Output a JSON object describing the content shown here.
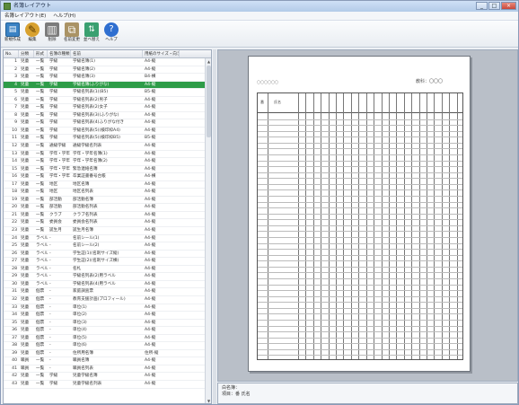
{
  "window": {
    "title": "名簿レイアウト",
    "controls": [
      "_",
      "□",
      "×"
    ]
  },
  "menu": [
    {
      "label": "名簿レイアウト(E)"
    },
    {
      "label": "ヘルプ(H)"
    }
  ],
  "toolbar": [
    {
      "label": "新規作成",
      "icon": "new-doc-icon",
      "glyph": "▤"
    },
    {
      "label": "編集",
      "icon": "pencil-icon",
      "glyph": "✎"
    },
    {
      "label": "削除",
      "icon": "trash-icon",
      "glyph": "▥"
    },
    {
      "label": "名前変更",
      "icon": "copy-icon",
      "glyph": "⧉"
    },
    {
      "label": "並べ替え",
      "icon": "sort-icon",
      "glyph": "⇅"
    },
    {
      "label": "ヘルプ",
      "icon": "help-icon",
      "glyph": "?"
    }
  ],
  "list": {
    "columns": [
      "No.",
      "分類",
      "形式",
      "名簿の種類",
      "名前",
      "用紙のサイズ・向き"
    ],
    "selected_index": 3,
    "rows": [
      [
        "1",
        "児童",
        "一覧",
        "学級",
        "学級名簿(1)",
        "A4-縦"
      ],
      [
        "2",
        "児童",
        "一覧",
        "学級",
        "学級名簿(2)",
        "A4-縦"
      ],
      [
        "3",
        "児童",
        "一覧",
        "学級",
        "学級名簿(3)",
        "B4-横"
      ],
      [
        "4",
        "児童",
        "一覧",
        "学級",
        "学級名簿(ふりがな)",
        "A4-縦"
      ],
      [
        "5",
        "児童",
        "一覧",
        "学級",
        "学級名列表(1)(B5)",
        "B5-縦"
      ],
      [
        "6",
        "児童",
        "一覧",
        "学級",
        "学級名列表(2)男子",
        "A4-縦"
      ],
      [
        "7",
        "児童",
        "一覧",
        "学級",
        "学級名列表(2)女子",
        "A4-縦"
      ],
      [
        "8",
        "児童",
        "一覧",
        "学級",
        "学級名列表(3)(ふりがな)",
        "A4-縦"
      ],
      [
        "9",
        "児童",
        "一覧",
        "学級",
        "学級名列表(4)ふりがな付き",
        "A4-縦"
      ],
      [
        "10",
        "児童",
        "一覧",
        "学級",
        "学級名列表(5)(検印枠A4)",
        "A4-縦"
      ],
      [
        "11",
        "児童",
        "一覧",
        "学級",
        "学級名列表(5)(検印枠B5)",
        "B5-縦"
      ],
      [
        "12",
        "児童",
        "一覧",
        "通級学級",
        "通級学級名列表",
        "A4-縦"
      ],
      [
        "13",
        "児童",
        "一覧",
        "学年・学年",
        "学年・学年名簿(1)",
        "A4-縦"
      ],
      [
        "14",
        "児童",
        "一覧",
        "学年・学年",
        "学年・学年名簿(2)",
        "A4-縦"
      ],
      [
        "15",
        "児童",
        "一覧",
        "学年・学年",
        "緊急連絡名簿",
        "A4-縦"
      ],
      [
        "16",
        "児童",
        "一覧",
        "学年・学年",
        "卒業証書番号台帳",
        "A4-横"
      ],
      [
        "17",
        "児童",
        "一覧",
        "地区",
        "地区名簿",
        "A4-縦"
      ],
      [
        "18",
        "児童",
        "一覧",
        "地区",
        "地区名列表",
        "A4-縦"
      ],
      [
        "19",
        "児童",
        "一覧",
        "部活動",
        "部活動名簿",
        "A4-縦"
      ],
      [
        "20",
        "児童",
        "一覧",
        "部活動",
        "部活動名列表",
        "A4-縦"
      ],
      [
        "21",
        "児童",
        "一覧",
        "クラブ",
        "クラブ名列表",
        "A4-縦"
      ],
      [
        "22",
        "児童",
        "一覧",
        "委員会",
        "委員会名列表",
        "A4-縦"
      ],
      [
        "23",
        "児童",
        "一覧",
        "誕生月",
        "誕生月名簿",
        "A4-縦"
      ],
      [
        "24",
        "児童",
        "ラベル",
        "-",
        "名前シール(1)",
        "A4-縦"
      ],
      [
        "25",
        "児童",
        "ラベル",
        "-",
        "名前シール(2)",
        "A4-縦"
      ],
      [
        "26",
        "児童",
        "ラベル",
        "-",
        "学生証(1)(名刺サイズ縦)",
        "A4-縦"
      ],
      [
        "27",
        "児童",
        "ラベル",
        "-",
        "学生証(2)(名刺サイズ横)",
        "A4-縦"
      ],
      [
        "28",
        "児童",
        "ラベル",
        "-",
        "名札",
        "A4-縦"
      ],
      [
        "29",
        "児童",
        "ラベル",
        "-",
        "学級名列表(2)用ラベル",
        "A4-縦"
      ],
      [
        "30",
        "児童",
        "ラベル",
        "-",
        "学級名列表(4)用ラベル",
        "A4-縦"
      ],
      [
        "31",
        "児童",
        "個票",
        "-",
        "家庭調査票",
        "A4-縦"
      ],
      [
        "32",
        "児童",
        "個票",
        "-",
        "教育支援計画(プロフィール)",
        "A4-縦"
      ],
      [
        "33",
        "児童",
        "個票",
        "-",
        "単位(1)",
        "A4-縦"
      ],
      [
        "34",
        "児童",
        "個票",
        "-",
        "単位(2)",
        "A4-縦"
      ],
      [
        "35",
        "児童",
        "個票",
        "-",
        "単位(3)",
        "A4-縦"
      ],
      [
        "36",
        "児童",
        "個票",
        "-",
        "単位(4)",
        "A4-縦"
      ],
      [
        "37",
        "児童",
        "個票",
        "-",
        "単位(5)",
        "A4-縦"
      ],
      [
        "38",
        "児童",
        "個票",
        "-",
        "単位(6)",
        "A4-縦"
      ],
      [
        "39",
        "児童",
        "個票",
        "-",
        "住所用名簿",
        "住所-縦"
      ],
      [
        "40",
        "職員",
        "一覧",
        "-",
        "職員名簿",
        "A4-縦"
      ],
      [
        "41",
        "職員",
        "一覧",
        "-",
        "職員名列表",
        "A4-縦"
      ],
      [
        "42",
        "児童",
        "一覧",
        "学級",
        "児童学級名簿",
        "A4-縦"
      ],
      [
        "43",
        "児童",
        "一覧",
        "学級",
        "児童学級名列表",
        "A4-縦"
      ]
    ]
  },
  "preview": {
    "sheet_label": "教科：〇〇〇",
    "header_small": "〇〇〇〇〇〇",
    "col_no": "番",
    "col_name": "氏名",
    "row_count": 42,
    "day_columns": 22
  },
  "status": {
    "line1": "白名簿：",
    "line2": "項目：番 氏名"
  }
}
